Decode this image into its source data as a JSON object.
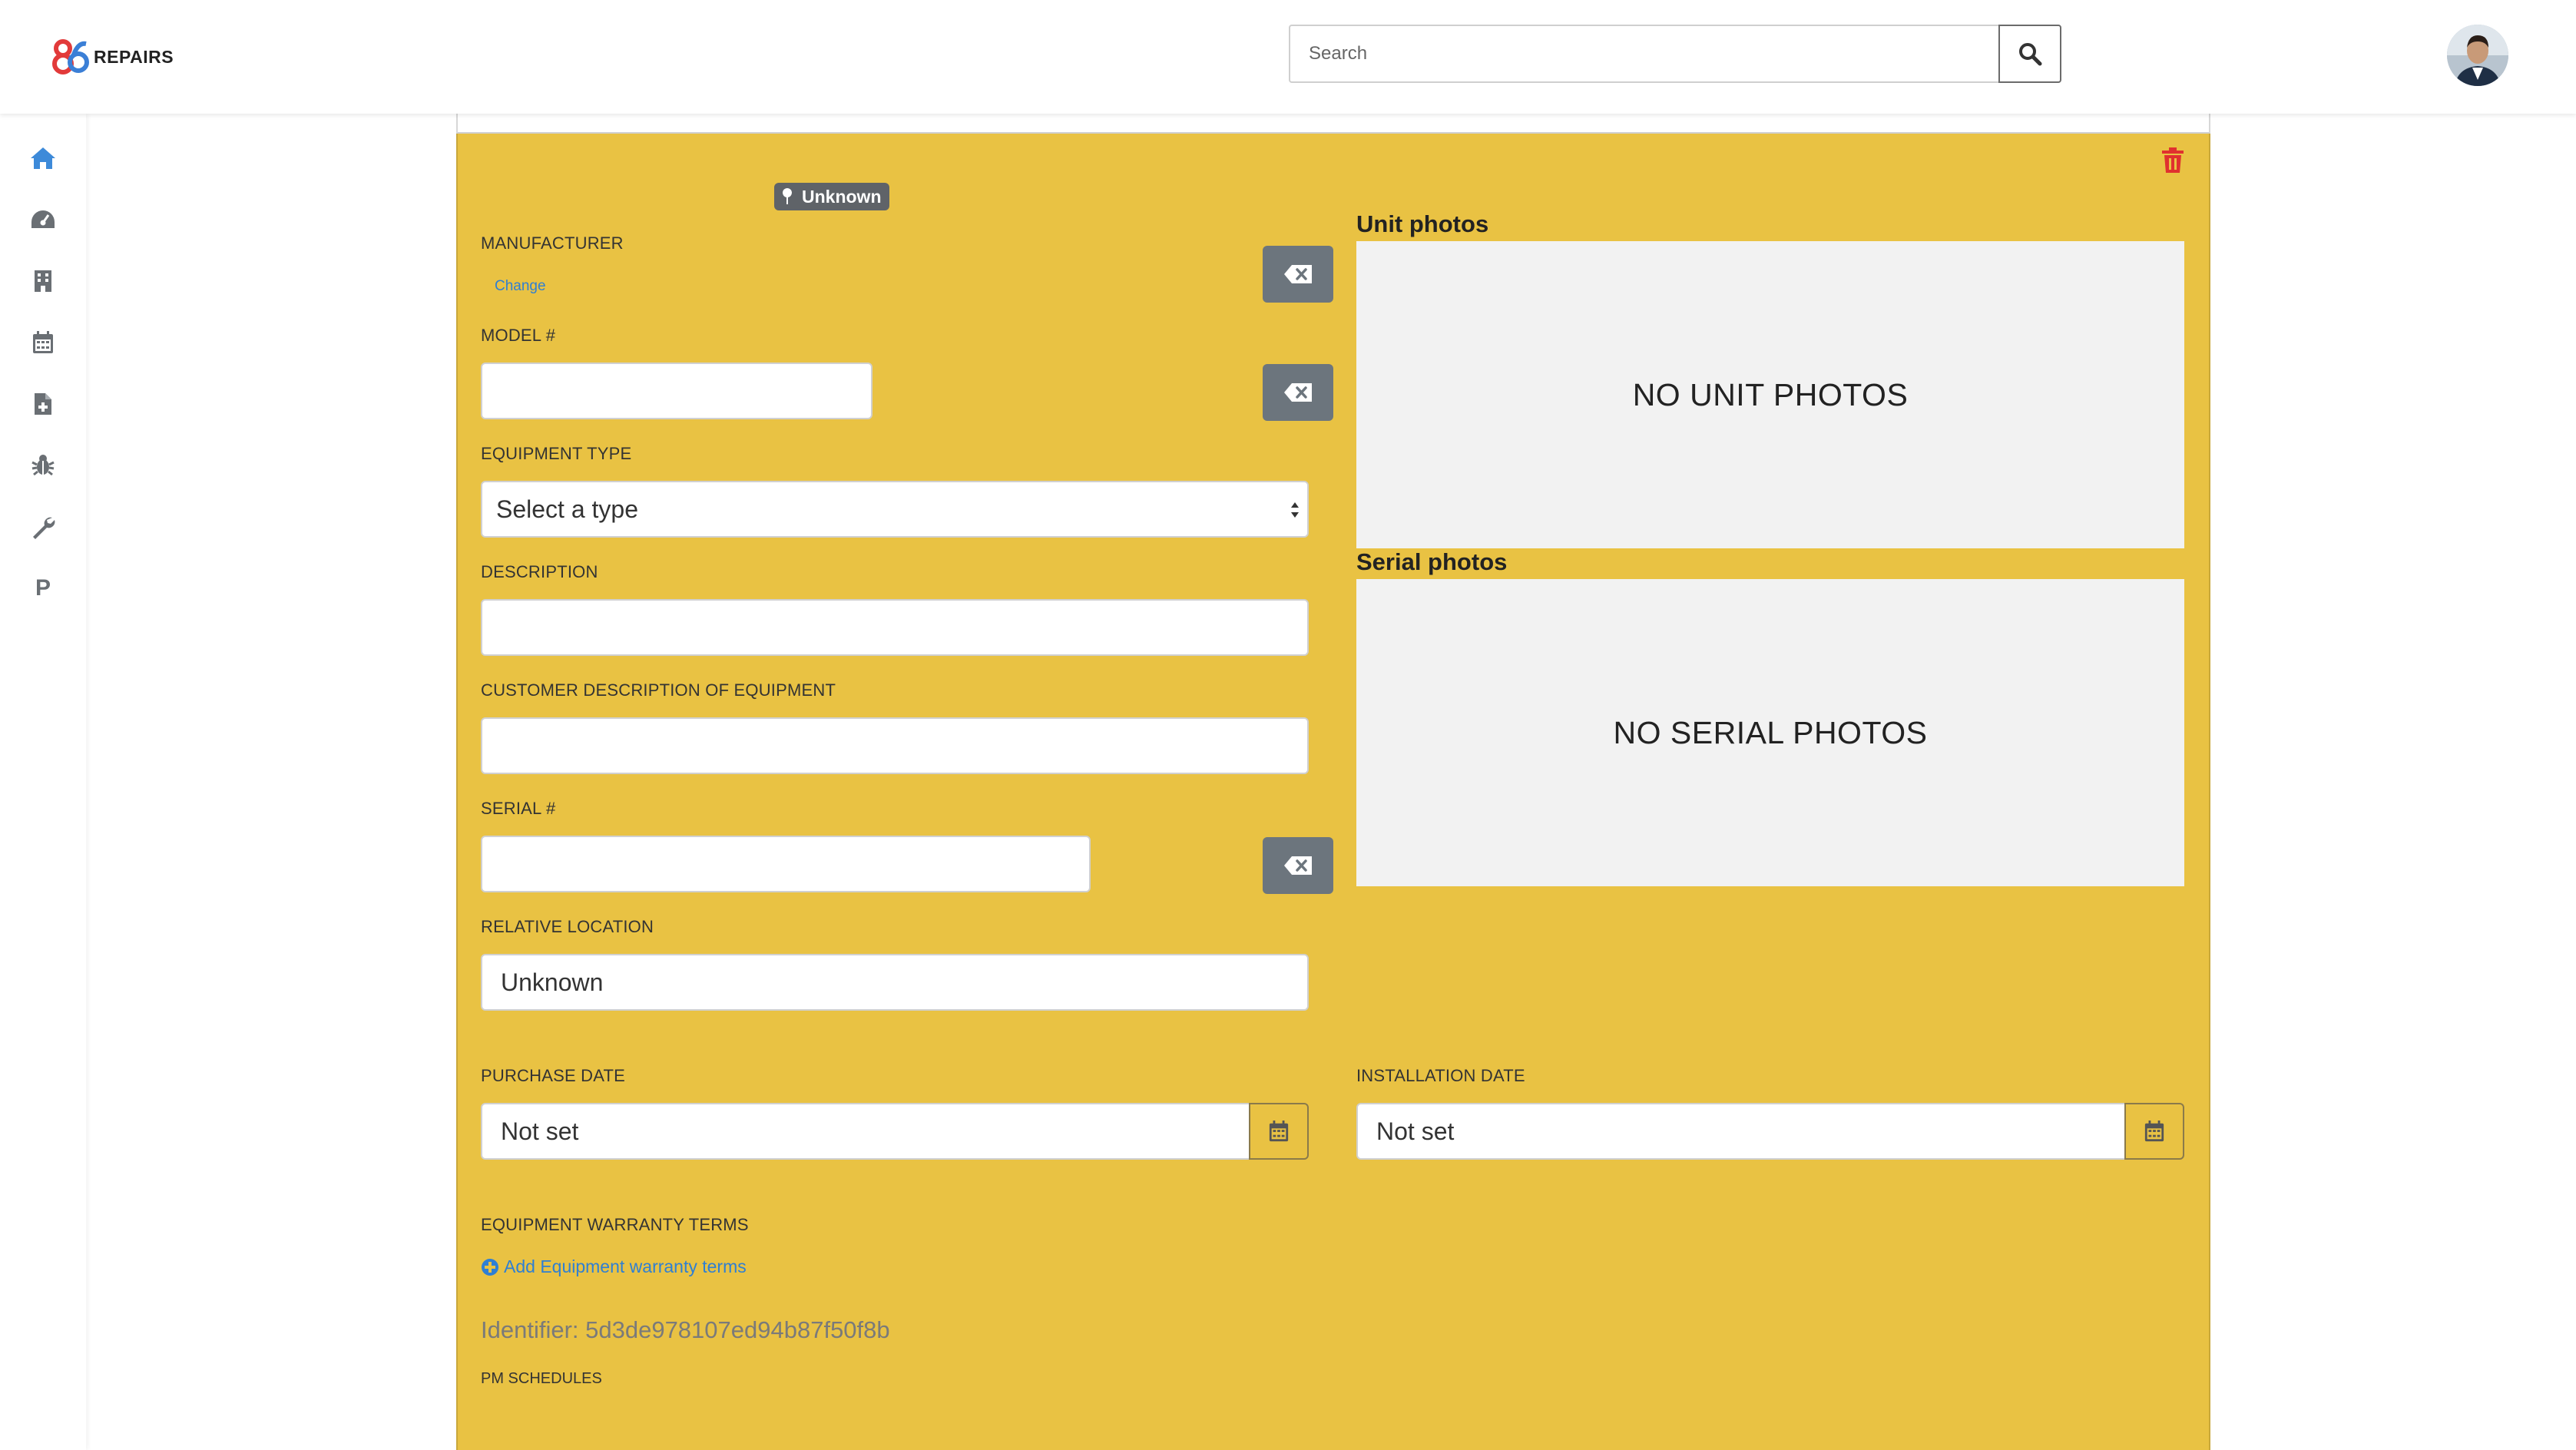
{
  "header": {
    "logo_text": "REPAIRS",
    "search_placeholder": "Search"
  },
  "sidebar": {
    "items": [
      {
        "icon": "home-icon"
      },
      {
        "icon": "dashboard-icon"
      },
      {
        "icon": "building-icon"
      },
      {
        "icon": "calendar-icon"
      },
      {
        "icon": "file-add-icon"
      },
      {
        "icon": "bug-icon"
      },
      {
        "icon": "wrench-icon"
      },
      {
        "label": "P"
      }
    ]
  },
  "equipment": {
    "location_badge": "Unknown",
    "manufacturer_label": "MANUFACTURER",
    "manufacturer_change": "Change",
    "model_label": "MODEL #",
    "model_value": "",
    "type_label": "EQUIPMENT TYPE",
    "type_selected": "Select a type",
    "description_label": "DESCRIPTION",
    "description_value": "",
    "customer_description_label": "CUSTOMER DESCRIPTION OF EQUIPMENT",
    "customer_description_value": "",
    "serial_label": "SERIAL #",
    "serial_value": "",
    "relative_location_label": "RELATIVE LOCATION",
    "relative_location_value": "Unknown",
    "unit_photos_title": "Unit photos",
    "unit_photos_empty": "NO UNIT PHOTOS",
    "serial_photos_title": "Serial photos",
    "serial_photos_empty": "NO SERIAL PHOTOS",
    "purchase_date_label": "PURCHASE DATE",
    "purchase_date_value": "Not set",
    "installation_date_label": "INSTALLATION DATE",
    "installation_date_value": "Not set",
    "warranty_label": "EQUIPMENT WARRANTY TERMS",
    "warranty_add": "Add Equipment warranty terms",
    "identifier": "Identifier: 5d3de978107ed94b87f50f8b",
    "pm_schedules_label": "PM SCHEDULES"
  },
  "colors": {
    "card_background": "#e9c243",
    "link": "#2f7fd3",
    "delete": "#e0312f",
    "button_gray": "#6c757d"
  }
}
